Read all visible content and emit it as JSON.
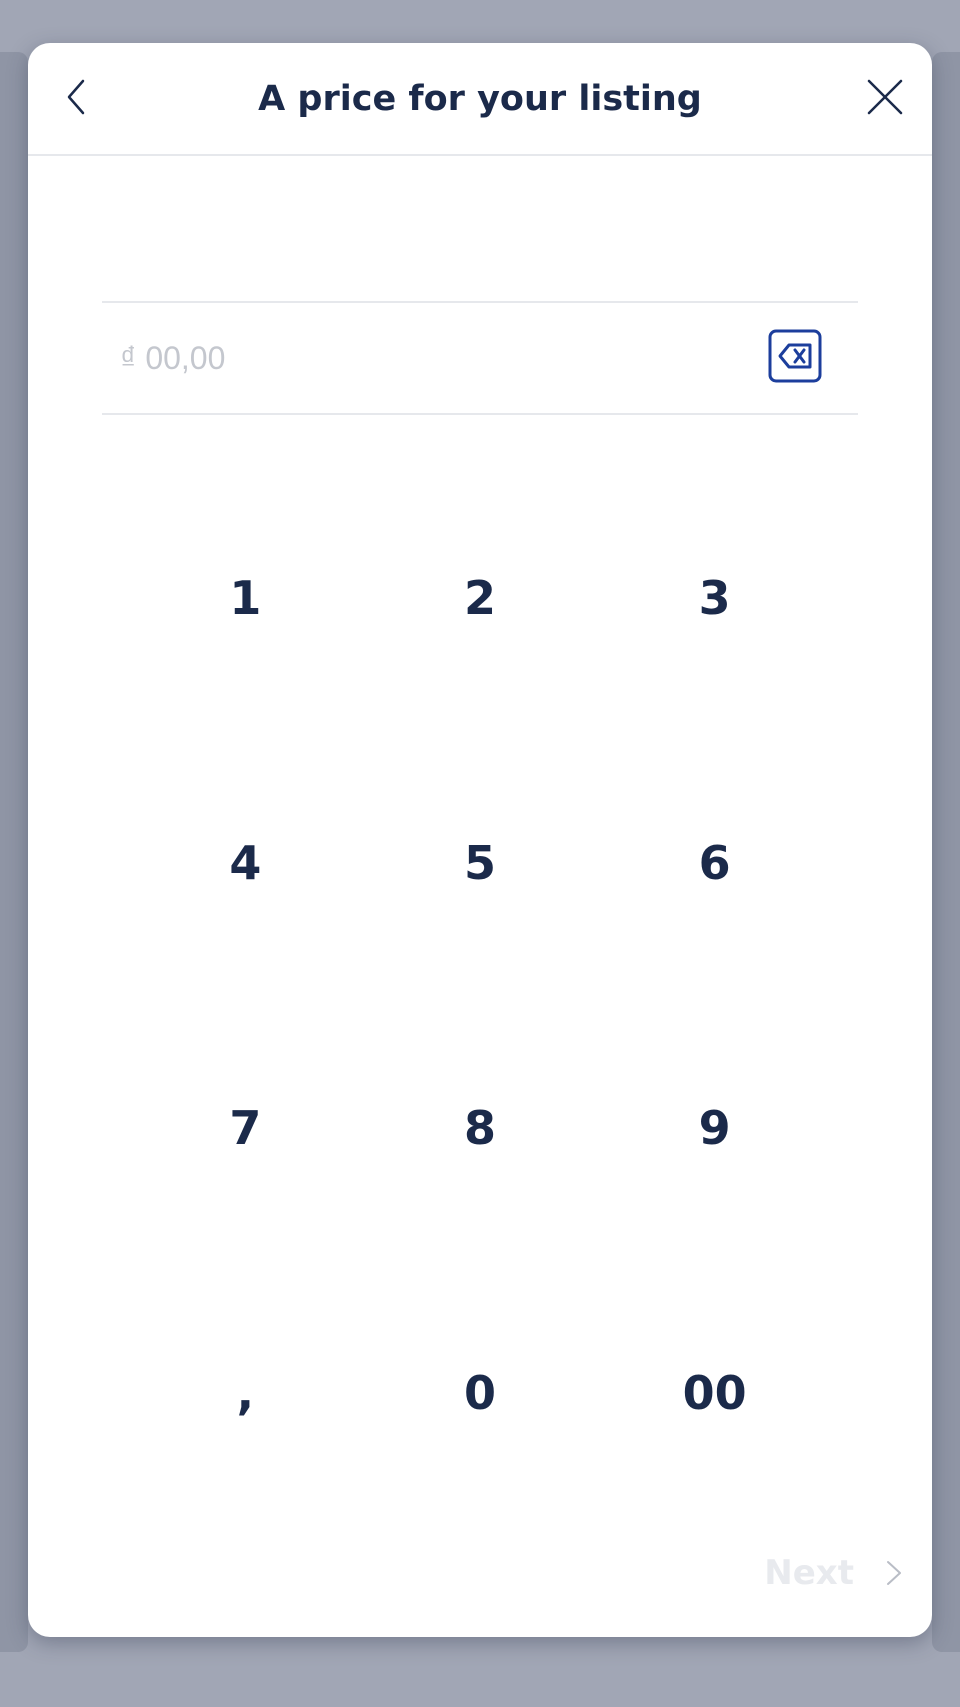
{
  "header": {
    "title": "A price for your listing",
    "back_icon": "chevron-left-icon",
    "close_icon": "close-icon"
  },
  "price": {
    "currency_symbol": "₫",
    "placeholder": "00,00",
    "backspace_icon": "backspace-icon"
  },
  "keypad": {
    "keys": [
      "1",
      "2",
      "3",
      "4",
      "5",
      "6",
      "7",
      "8",
      "9",
      ",",
      "0",
      "00"
    ]
  },
  "footer": {
    "next_label": "Next",
    "next_icon": "chevron-right-icon"
  },
  "colors": {
    "text_primary": "#1b2a4a",
    "accent_blue": "#1c3e9c",
    "placeholder": "#c4c7ce",
    "disabled": "#e8eaee",
    "backdrop": "#a1a6b5"
  }
}
